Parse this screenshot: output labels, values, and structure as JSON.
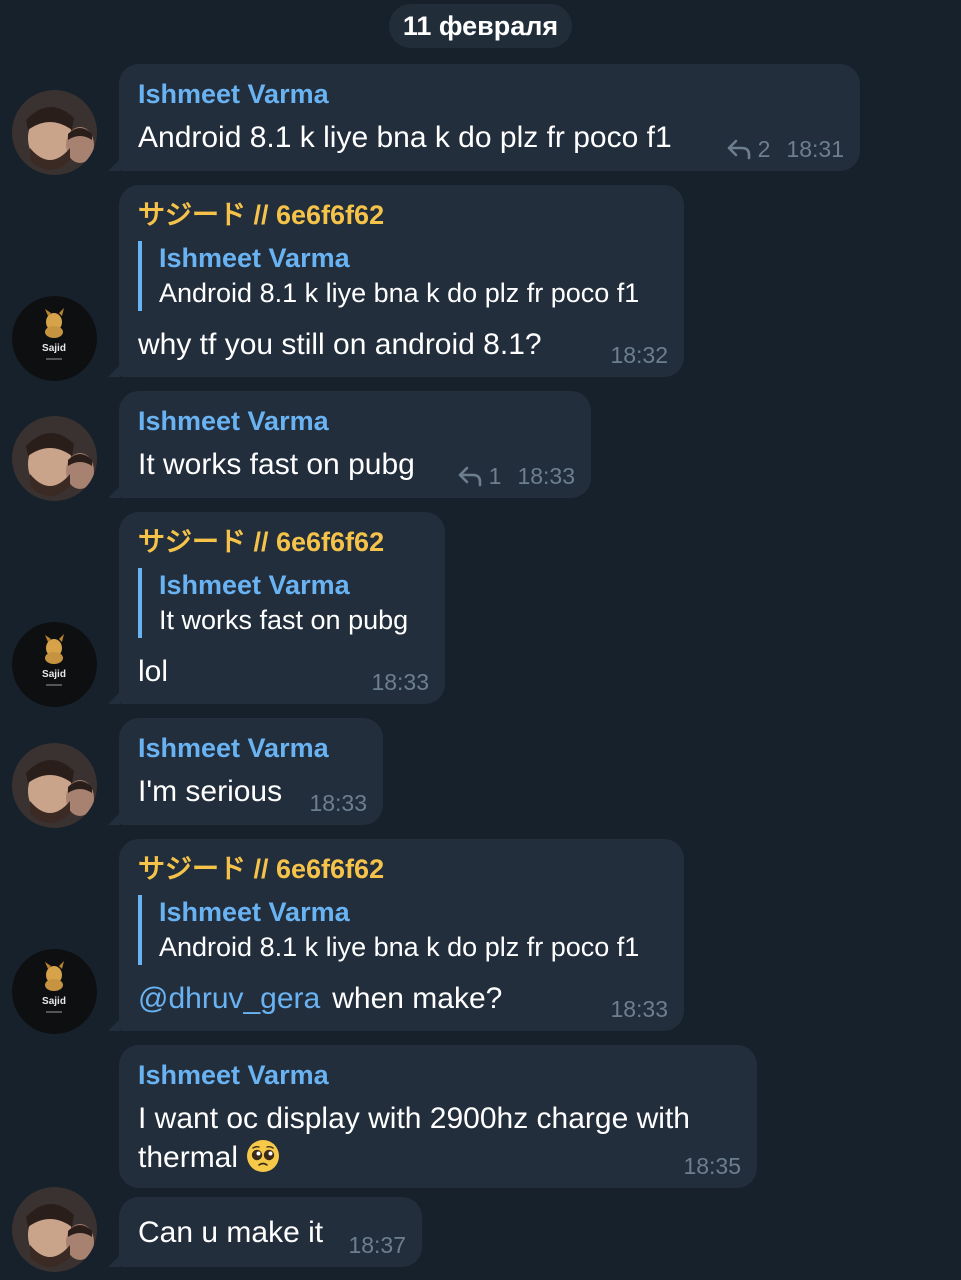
{
  "date_separator": "11 февраля",
  "users": {
    "ishmeet": "Ishmeet Varma",
    "sajid": "サジード // 6e6f6f62",
    "sajid_avatar_label": "Sajid"
  },
  "messages": [
    {
      "sender": "Ishmeet Varma",
      "text": "Android 8.1 k liye bna k do plz fr poco f1",
      "replies": "2",
      "time": "18:31"
    },
    {
      "sender": "サジード // 6e6f6f62",
      "reply_to_name": "Ishmeet Varma",
      "reply_to_text": "Android 8.1 k liye bna k do plz fr poco f1",
      "text": "why tf you still on android 8.1?",
      "time": "18:32"
    },
    {
      "sender": "Ishmeet Varma",
      "text": "It works fast on pubg",
      "replies": "1",
      "time": "18:33"
    },
    {
      "sender": "サジード // 6e6f6f62",
      "reply_to_name": "Ishmeet Varma",
      "reply_to_text": "It works fast on pubg",
      "text": "lol",
      "time": "18:33"
    },
    {
      "sender": "Ishmeet Varma",
      "text": "I'm serious",
      "time": "18:33"
    },
    {
      "sender": "サジード // 6e6f6f62",
      "reply_to_name": "Ishmeet Varma",
      "reply_to_text": "Android 8.1 k liye bna k do plz fr poco f1",
      "mention": "@dhruv_gera",
      "text": "when make?",
      "time": "18:33"
    },
    {
      "sender": "Ishmeet Varma",
      "text_line1": "I want oc display with 2900hz charge with",
      "text_line2": "thermal",
      "emoji": "pleading-face",
      "time": "18:35"
    },
    {
      "text": "Can u make it",
      "time": "18:37"
    }
  ],
  "colors": {
    "background": "#17212b",
    "bubble": "#232e3c",
    "name_blue": "#6ab3f3",
    "name_orange": "#f6c34a",
    "meta_gray": "#6d7f8f"
  }
}
